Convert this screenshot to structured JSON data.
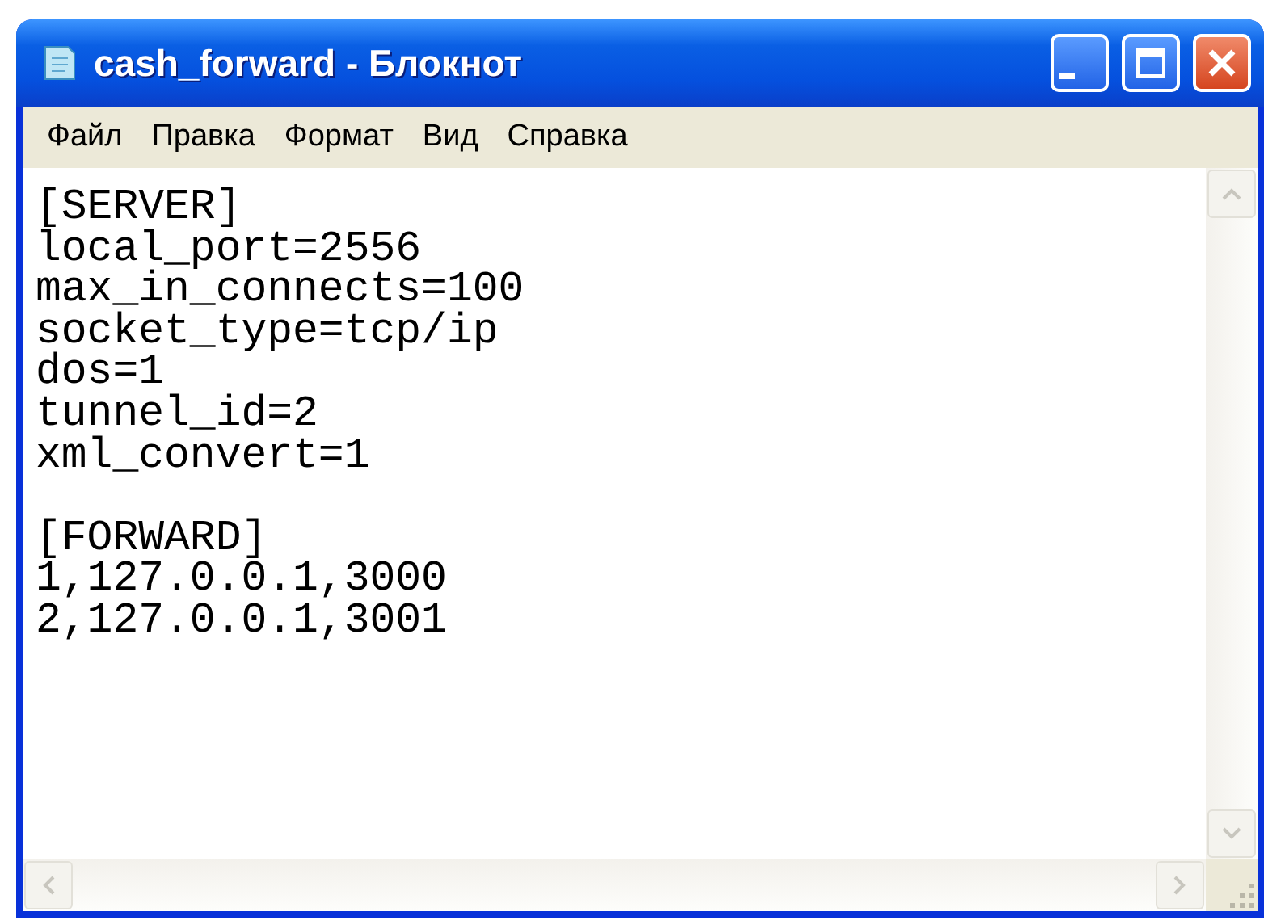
{
  "window": {
    "title": "cash_forward - Блокнот"
  },
  "menu": [
    "Файл",
    "Правка",
    "Формат",
    "Вид",
    "Справка"
  ],
  "document": {
    "sections": [
      {
        "lines": [
          "[SERVER]",
          "local_port=2556",
          "max_in_connects=100",
          "socket_type=tcp/ip",
          "dos=1",
          "tunnel_id=2",
          "xml_convert=1"
        ]
      },
      {
        "lines": [
          "[FORWARD]",
          "1,127.0.0.1,3000",
          "2,127.0.0.1,3001"
        ]
      }
    ]
  }
}
